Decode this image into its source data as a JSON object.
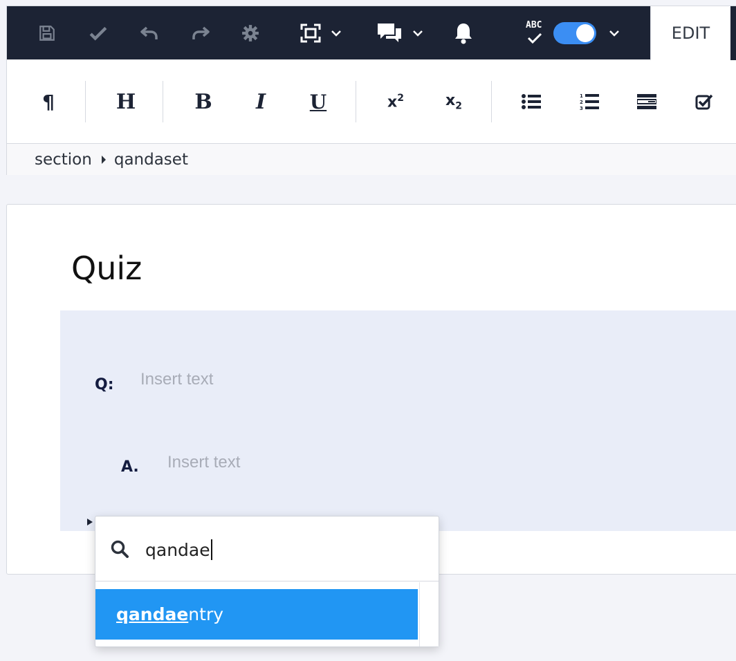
{
  "topbar": {
    "edit_tab": "EDIT",
    "spellcheck_label": "ABC",
    "spellcheck_toggle": "on",
    "buttons": [
      {
        "icon": "save-icon"
      },
      {
        "icon": "checkmark-icon"
      },
      {
        "icon": "undo-icon"
      },
      {
        "icon": "redo-icon"
      },
      {
        "icon": "gear-icon"
      },
      {
        "icon": "fullscreen-icon"
      },
      {
        "icon": "comments-icon"
      },
      {
        "icon": "bell-icon"
      },
      {
        "icon": "spellcheck-icon"
      }
    ]
  },
  "toolbar": {
    "paragraph": "¶",
    "heading": "H",
    "bold": "B",
    "italic": "I",
    "underline": "U",
    "superscript_base": "x",
    "superscript_exp": "2",
    "subscript_base": "x",
    "subscript_exp": "2"
  },
  "breadcrumb": {
    "items": [
      "section",
      "qandaset"
    ]
  },
  "document": {
    "title": "Quiz",
    "question_label": "Q:",
    "question_placeholder": "Insert text",
    "answer_label": "A.",
    "answer_placeholder": "Insert text"
  },
  "popup": {
    "search_value": "qandae",
    "results": [
      {
        "match": "qandae",
        "rest": "ntry",
        "selected": true
      }
    ]
  },
  "colors": {
    "topbar_bg": "#1c2334",
    "accent": "#2196f3",
    "toggle_on": "#3b8ef3",
    "qanda_bg": "#e9edf8",
    "label_color": "#141c40",
    "placeholder": "#a8acb7"
  }
}
